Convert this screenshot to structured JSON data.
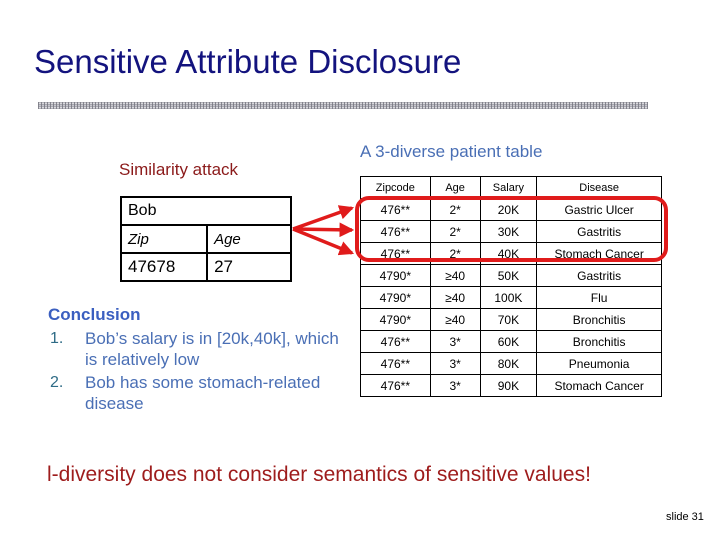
{
  "slide": {
    "title": "Sensitive Attribute Disclosure",
    "number_label": "slide 31",
    "takeaway": "l-diversity does not consider semantics of sensitive values!",
    "colors": {
      "title": "#13137e",
      "attack_label": "#8b1a1a",
      "caption": "#4a6fb5",
      "conclusion_heading": "#3b5fc0",
      "conclusion_text": "#4a6fb5",
      "list_number": "#2e6b86",
      "highlight": "#e01b1b",
      "takeaway": "#9e1c1c",
      "table_border": "#000000"
    }
  },
  "attack": {
    "label": "Similarity attack",
    "bob_table": {
      "name": "Bob",
      "attr_headers": [
        "Zip",
        "Age"
      ],
      "values": [
        "47678",
        "27"
      ]
    }
  },
  "patient_table": {
    "caption": "A 3-diverse patient table",
    "columns": [
      "Zipcode",
      "Age",
      "Salary",
      "Disease"
    ],
    "rows": [
      [
        "476**",
        "2*",
        "20K",
        "Gastric Ulcer"
      ],
      [
        "476**",
        "2*",
        "30K",
        "Gastritis"
      ],
      [
        "476**",
        "2*",
        "40K",
        "Stomach Cancer"
      ],
      [
        "4790*",
        "≥40",
        "50K",
        "Gastritis"
      ],
      [
        "4790*",
        "≥40",
        "100K",
        "Flu"
      ],
      [
        "4790*",
        "≥40",
        "70K",
        "Bronchitis"
      ],
      [
        "476**",
        "3*",
        "60K",
        "Bronchitis"
      ],
      [
        "476**",
        "3*",
        "80K",
        "Pneumonia"
      ],
      [
        "476**",
        "3*",
        "90K",
        "Stomach Cancer"
      ]
    ],
    "highlighted_rows": [
      0,
      1,
      2
    ]
  },
  "conclusion": {
    "heading": "Conclusion",
    "items": [
      {
        "number": "1.",
        "text": "Bob’s salary is in [20k,40k], which is relatively low"
      },
      {
        "number": "2.",
        "text": "Bob has some stomach-related disease"
      }
    ]
  }
}
